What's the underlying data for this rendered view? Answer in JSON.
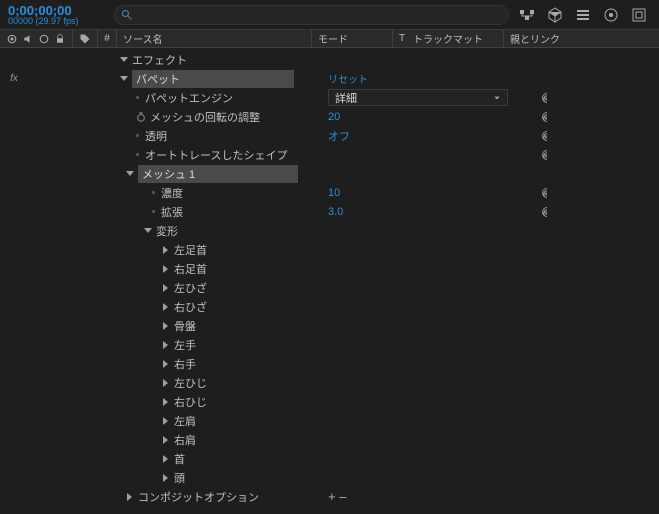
{
  "timecode": "0;00;00;00",
  "timecode_sub": "00000 (29.97 fps)",
  "search": {
    "value": ""
  },
  "columns": {
    "source": "ソース名",
    "mode": "モード",
    "t": "T",
    "trackmatte": "トラックマット",
    "parent": "親とリンク",
    "hash": "#"
  },
  "labels": {
    "fx": "fx",
    "effects": "エフェクト",
    "puppet": "パペット",
    "reset": "リセット",
    "puppet_engine": "パペットエンジン",
    "engine_value": "詳細",
    "mesh_rotation": "メッシュの回転の調整",
    "mesh_rotation_val": "20",
    "transparent": "透明",
    "transparent_val": "オフ",
    "autotrace": "オートトレースしたシェイプ",
    "mesh1": "メッシュ 1",
    "density": "濃度",
    "density_val": "10",
    "expansion": "拡張",
    "expansion_val": "3.0",
    "deform": "変形",
    "composite_options": "コンポジットオプション",
    "plusminus": "+ –"
  },
  "pins": [
    "左足首",
    "右足首",
    "左ひざ",
    "右ひざ",
    "骨盤",
    "左手",
    "右手",
    "左ひじ",
    "右ひじ",
    "左肩",
    "右肩",
    "首",
    "頭"
  ]
}
